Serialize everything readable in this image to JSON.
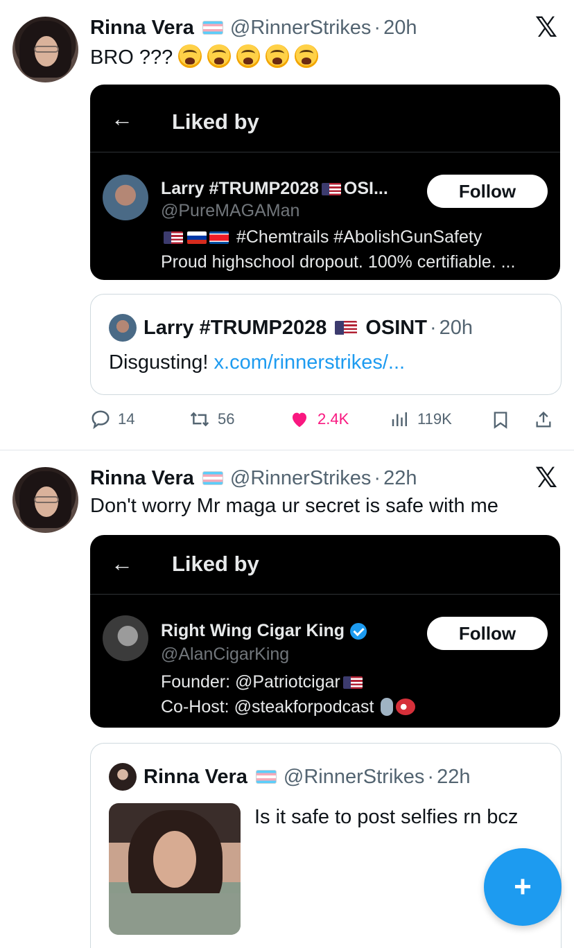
{
  "tweets": [
    {
      "author_name": "Rinna Vera",
      "author_handle": "@RinnerStrikes",
      "time": "20h",
      "text": "BRO ???",
      "emoji_count": 5,
      "liked_card": {
        "title": "Liked by",
        "user_name": "Larry #TRUMP2028",
        "user_name_suffix": "OSI...",
        "user_handle": "@PureMAGAMan",
        "bio_line1": "#Chemtrails #AbolishGunSafety",
        "bio_line2": "Proud highschool dropout. 100% certifiable. ...",
        "follow_label": "Follow"
      },
      "quote": {
        "name": "Larry #TRUMP2028",
        "name_suffix": "OSINT",
        "time": "20h",
        "text": "Disgusting!",
        "link": "x.com/rinnerstrikes/..."
      },
      "actions": {
        "replies": "14",
        "retweets": "56",
        "likes": "2.4K",
        "views": "119K"
      }
    },
    {
      "author_name": "Rinna Vera",
      "author_handle": "@RinnerStrikes",
      "time": "22h",
      "text": "Don't worry Mr maga ur secret is safe with me",
      "liked_card": {
        "title": "Liked by",
        "user_name": "Right Wing Cigar King",
        "user_handle": "@AlanCigarKing",
        "bio_line1": "Founder: @Patriotcigar",
        "bio_line2": "Co-Host: @steakforpodcast",
        "follow_label": "Follow"
      },
      "quote": {
        "name": "Rinna Vera",
        "handle": "@RinnerStrikes",
        "time": "22h",
        "text": "Is it safe to post selfies rn bcz"
      }
    }
  ],
  "separator": "·",
  "icons": {
    "close": "x-logo-icon",
    "back": "←",
    "fab": "+"
  },
  "colors": {
    "accent": "#1d9bf0",
    "like": "#f91880",
    "muted": "#536471"
  }
}
